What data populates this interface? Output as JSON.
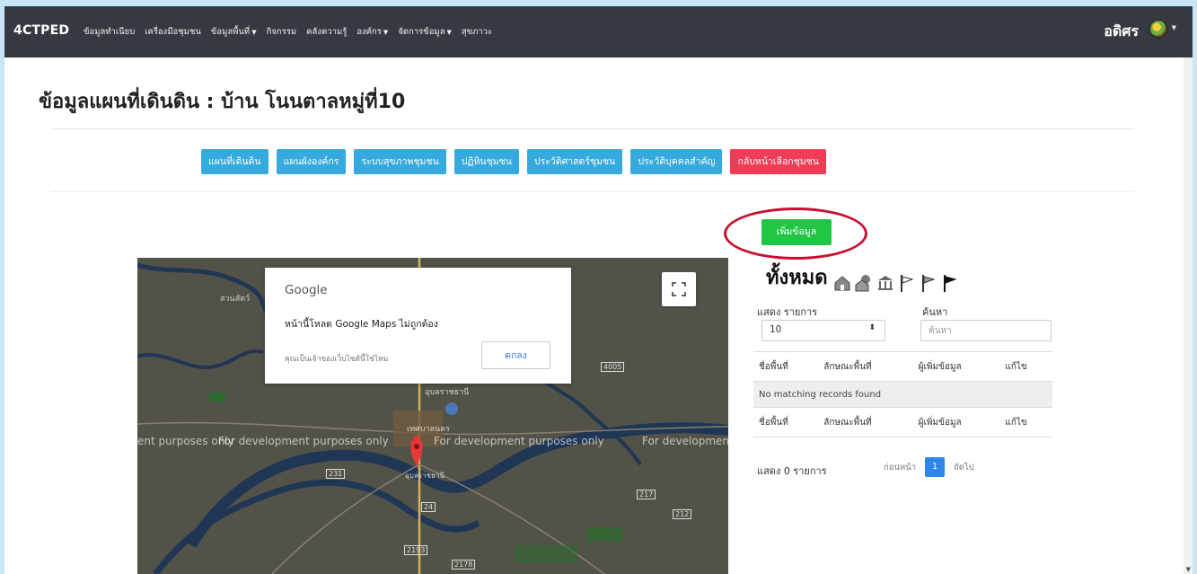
{
  "navbar": {
    "brand": "4CTPED",
    "items": [
      {
        "label": "ข้อมูลทำเนียบ",
        "dropdown": false
      },
      {
        "label": "เครื่องมือชุมชน",
        "dropdown": false
      },
      {
        "label": "ข้อมูลพื้นที่",
        "dropdown": true
      },
      {
        "label": "กิจกรรม",
        "dropdown": false
      },
      {
        "label": "คลังความรู้",
        "dropdown": false
      },
      {
        "label": "องค์กร",
        "dropdown": true
      },
      {
        "label": "จัดการข้อมูล",
        "dropdown": true
      },
      {
        "label": "สุขภาวะ",
        "dropdown": false
      }
    ],
    "caret": "▼",
    "user": "อดิศร",
    "user_caret": "▼"
  },
  "page": {
    "title": "ข้อมูลแผนที่เดินดิน : บ้าน โนนตาลหมู่ที่10"
  },
  "buttons": [
    {
      "label": "แผนที่เดินดิน",
      "color": "#36a9de"
    },
    {
      "label": "แผนผังองค์กร",
      "color": "#36a9de"
    },
    {
      "label": "ระบบสุขภาพชุมชน",
      "color": "#36a9de"
    },
    {
      "label": "ปฏิทินชุมชน",
      "color": "#36a9de"
    },
    {
      "label": "ประวัติศาสตร์ชุมชน",
      "color": "#36a9de"
    },
    {
      "label": "ประวัติบุคคลสำคัญ",
      "color": "#36a9de"
    },
    {
      "label": "กลับหน้าเลือกชุมชน",
      "color": "#f03c57"
    }
  ],
  "add_button": {
    "label": "เพิ่มข้อมูล",
    "color": "#20c644"
  },
  "summary": {
    "title": "ทั้งหมด",
    "icons": [
      "house-icon",
      "house-tree-icon",
      "temple-icon",
      "flag-outline-icon",
      "flag-gray-icon",
      "flag-black-icon"
    ]
  },
  "table_controls": {
    "show_label": "แสดง รายการ",
    "page_size": "10",
    "search_label": "ค้นหา",
    "search_placeholder": "ค้นหา"
  },
  "table": {
    "columns": [
      "ชื่อพื้นที่",
      "ลักษณะพื้นที่",
      "ผู้เพิ่มข้อมูล",
      "แก้ไข"
    ],
    "empty_message": "No matching records found"
  },
  "footer": {
    "info": "แสดง 0 รายการ",
    "prev": "ก่อนหน้า",
    "page": "1",
    "next": "ถัดไป"
  },
  "map": {
    "watermark": "For development purposes only",
    "labels": [
      "สวนสัตว์",
      "อุบลราชธานี",
      "เทศบาลนคร",
      "อุบลราชธานี"
    ],
    "road_numbers": [
      "231",
      "24",
      "2193",
      "2178",
      "217",
      "4005",
      "212"
    ],
    "dialog": {
      "logo": "Google",
      "message": "หน้านี้โหลด Google Maps ไม่ถูกต้อง",
      "question": "คุณเป็นเจ้าของเว็บไซต์นี้ใช่ไหม",
      "ok": "ตกลง"
    }
  }
}
